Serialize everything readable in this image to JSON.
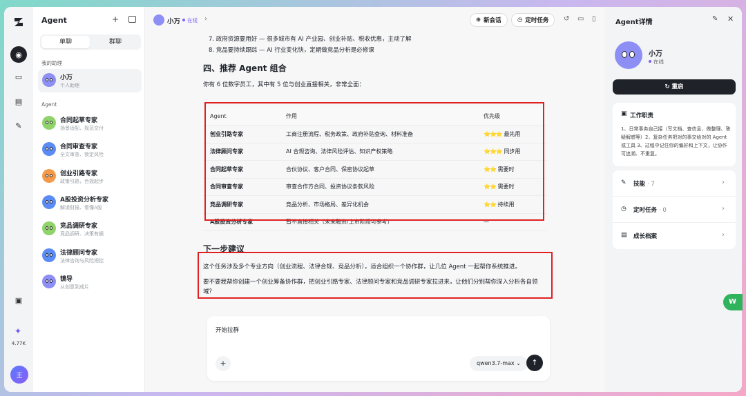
{
  "rail": {
    "count": "4.77K",
    "avatar_text": "王"
  },
  "sidebar": {
    "title": "Agent",
    "tabs": [
      "单聊",
      "群聊"
    ],
    "assistant_group": "我的助理",
    "assistant": {
      "name": "小万",
      "desc": "个人助理"
    },
    "agent_group": "Agent",
    "agents": [
      {
        "name": "合同起草专家",
        "desc": "场景适配、规范交付",
        "color": "#8fd36a"
      },
      {
        "name": "合同审查专家",
        "desc": "全文审查、锁定风险",
        "color": "#5b8cf5"
      },
      {
        "name": "创业引路专家",
        "desc": "政策引路，合规起步",
        "color": "#f59a4a"
      },
      {
        "name": "A股投资分析专家",
        "desc": "解读财报、看懂A股",
        "color": "#5b8cf5"
      },
      {
        "name": "竞品调研专家",
        "desc": "竞品调研、决策有据",
        "color": "#8fd36a"
      },
      {
        "name": "法律顾问专家",
        "desc": "法律咨询与风险把控",
        "color": "#5b8cf5"
      },
      {
        "name": "镜导",
        "desc": "从创意到成片",
        "color": "#8d8ff5"
      }
    ]
  },
  "topbar": {
    "name": "小万",
    "status": "在线",
    "new_chat": "新会话",
    "scheduled": "定时任务"
  },
  "content": {
    "line7": "7. 政府资源要用好 — 很多城市有 AI 产业园、创业补贴、税收优惠，主动了解",
    "line8": "8. 竞品要持续跟踪 — AI 行业变化快，定期做竞品分析是必修课",
    "heading4": "四、推荐 Agent 组合",
    "intro": "你有 6 位数字员工，其中有 5 位与创业直接相关，非常全面：",
    "table": {
      "headers": [
        "Agent",
        "作用",
        "优先级"
      ],
      "rows": [
        {
          "agent": "创业引路专家",
          "role": "工商注册流程、税务政策、政府补贴查询、材料准备",
          "stars": "⭐⭐⭐",
          "priority": "最先用"
        },
        {
          "agent": "法律顾问专家",
          "role": "AI 合规咨询、法律风险评估、知识产权策略",
          "stars": "⭐⭐⭐",
          "priority": "同步用"
        },
        {
          "agent": "合同起草专家",
          "role": "合伙协议、客户合同、保密协议起草",
          "stars": "⭐⭐",
          "priority": "需要时"
        },
        {
          "agent": "合同审查专家",
          "role": "审查合作方合同、投资协议条款风险",
          "stars": "⭐⭐",
          "priority": "需要时"
        },
        {
          "agent": "竞品调研专家",
          "role": "竞品分析、市场格局、差异化机会",
          "stars": "⭐⭐",
          "priority": "持续用"
        },
        {
          "agent": "A股投资分析专家",
          "role": "暂不直接相关（未来融资/上市阶段可参考）",
          "stars": "",
          "priority": "—"
        }
      ]
    },
    "next_heading": "下一步建议",
    "para1": "这个任务涉及多个专业方向（创业流程、法律合规、竞品分析），适合组织一个协作群，让几位 Agent 一起帮你系统推进。",
    "para2a": "要不要我帮你创建一个创业筹备协作群，把创业引路专家、法律顾问专家和竞品调研专家拉进来，让他们分别帮你深入分析各自领",
    "para2b": "域？"
  },
  "composer": {
    "text": "开始拉群",
    "model": "qwen3.7-max"
  },
  "right": {
    "title": "Agent详情",
    "name": "小万",
    "status": "在线",
    "restart": "重启",
    "duty_title": "工作职责",
    "duty_desc": "1、日常事务自己接（写文档、查信息、做整理、答疑解惑等）2、复杂任务把对的事交给对的 Agent 或工具 3、过程中记住你的偏好和上下文，让协作可追溯、不重复。",
    "skills": "技能",
    "skills_count": "· 7",
    "tasks": "定时任务",
    "tasks_count": "· 0",
    "growth": "成长档案"
  },
  "float_badge": "W"
}
